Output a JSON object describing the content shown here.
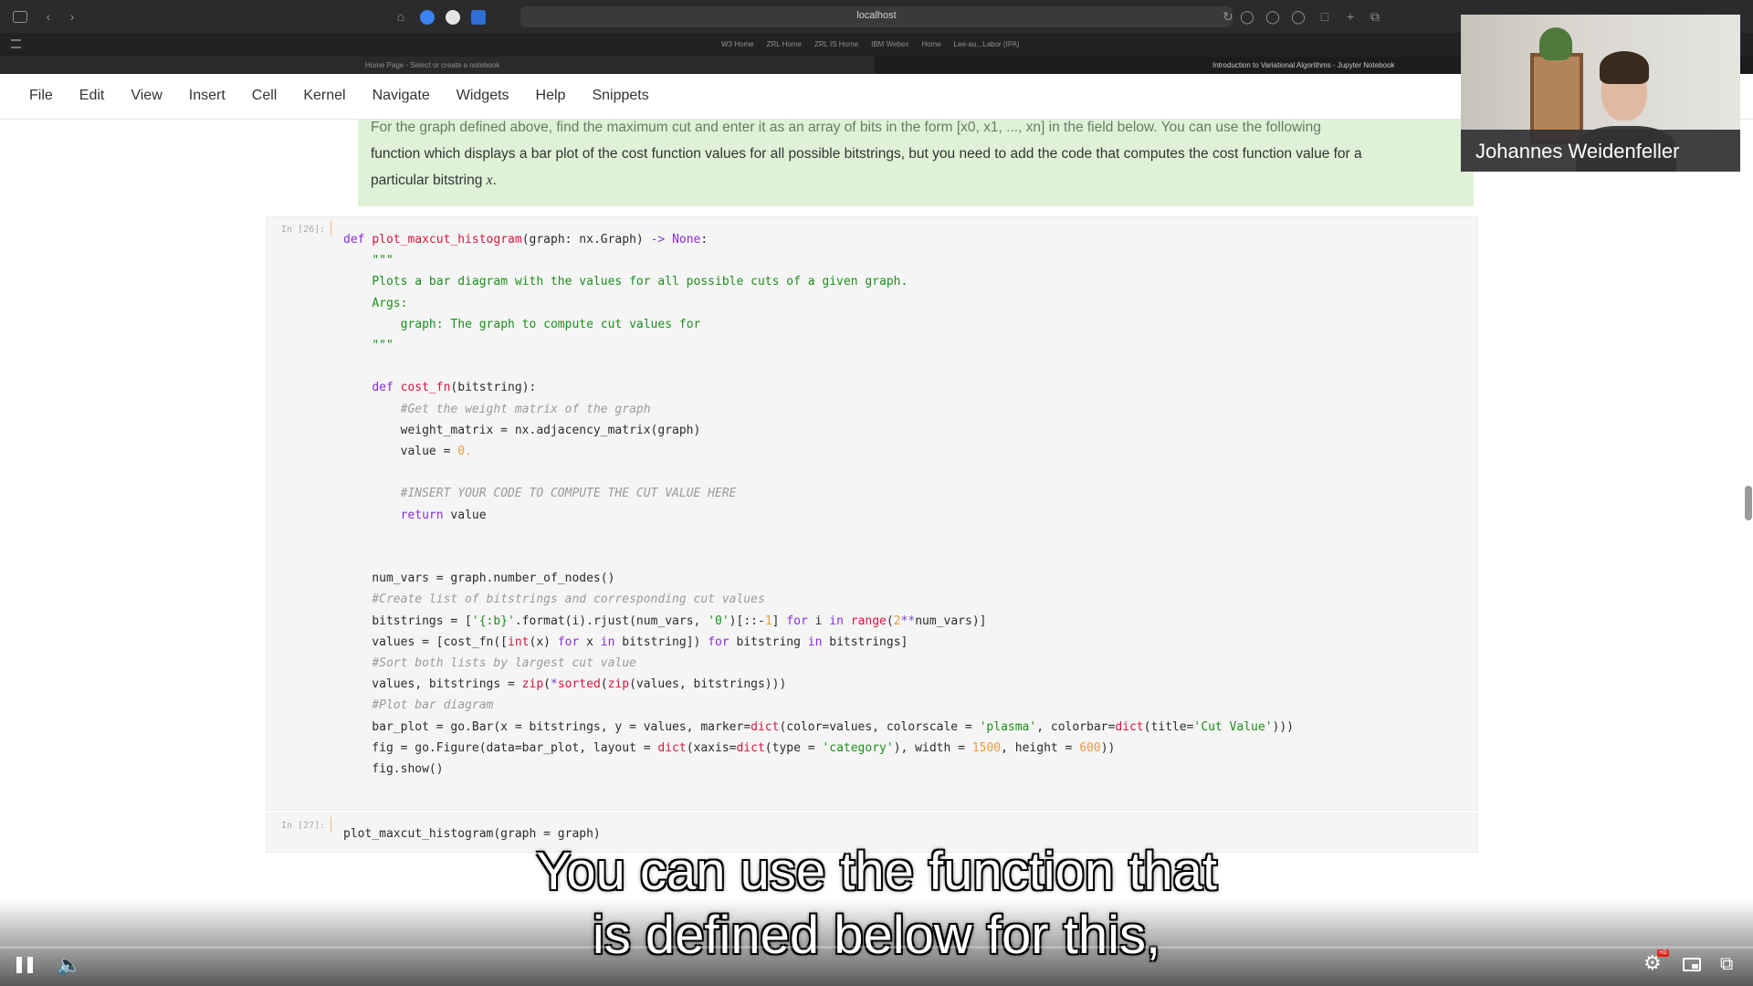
{
  "browser": {
    "url": "localhost",
    "favorites": [
      "W3 Home",
      "ZRL Home",
      "ZRL IS Home",
      "IBM Webex",
      "Home",
      "Lee-au...Labor (IPA)"
    ],
    "tabs": [
      {
        "title": "Home Page - Select or create a notebook"
      },
      {
        "title": "Introduction to Variational Algorithms - Jupyter Notebook"
      }
    ]
  },
  "menubar": {
    "items": [
      "File",
      "Edit",
      "View",
      "Insert",
      "Cell",
      "Kernel",
      "Navigate",
      "Widgets",
      "Help",
      "Snippets"
    ]
  },
  "markdown_cell": {
    "line_clipped": "For the graph defined above, find the maximum cut and enter it as an array of bits in the form [x0, x1, ..., xn] in the field below. You can use the following",
    "line_2": "function which displays a bar plot of the cost function values for all possible bitstrings, but you need to add the code that computes the cost function value for a",
    "line_3_prefix": "particular bitstring ",
    "line_3_var": "x",
    "line_3_suffix": "."
  },
  "cells": {
    "cell_26_prompt": "In [26]:",
    "cell_27_prompt": "In [27]:",
    "cell_27_code": "plot_maxcut_histogram(graph = graph)"
  },
  "webcam": {
    "name": "Johannes Weidenfeller"
  },
  "subtitles": {
    "line_1": "You can use the function that",
    "line_2": "is defined below for this,"
  },
  "player": {
    "hd_label": "HD"
  }
}
